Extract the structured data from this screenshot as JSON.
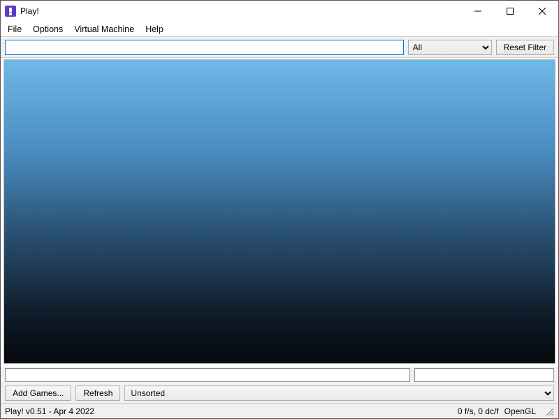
{
  "window": {
    "title": "Play!"
  },
  "menu": {
    "file": "File",
    "options": "Options",
    "virtual_machine": "Virtual Machine",
    "help": "Help"
  },
  "filterbar": {
    "search_value": "",
    "search_placeholder": "",
    "filter_selected": "All",
    "reset_label": "Reset Filter"
  },
  "info": {
    "left_value": "",
    "right_value": ""
  },
  "buttons": {
    "add_games": "Add Games...",
    "refresh": "Refresh",
    "sort_selected": "Unsorted"
  },
  "status": {
    "version": "Play! v0.51 - Apr  4 2022",
    "perf": "0 f/s, 0 dc/f",
    "renderer": "OpenGL"
  }
}
